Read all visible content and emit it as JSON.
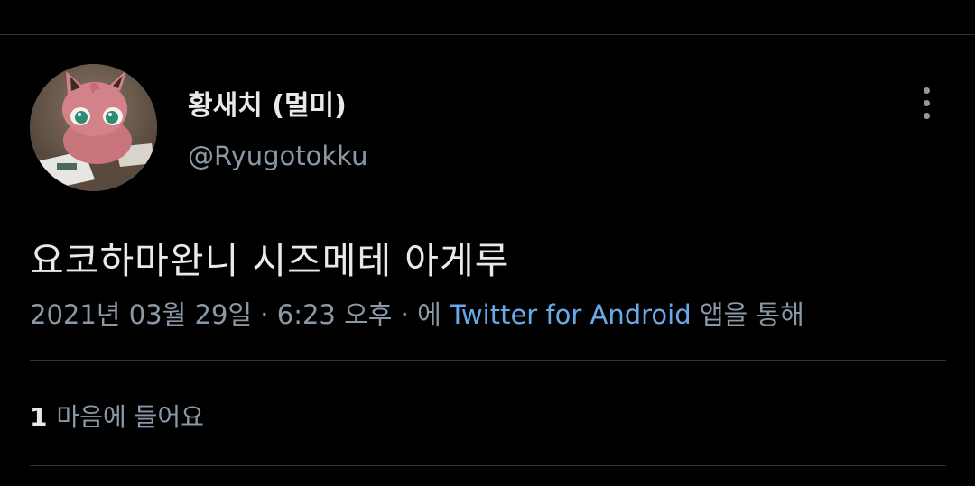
{
  "tweet": {
    "author": {
      "display_name": "황새치 (멀미)",
      "handle": "@Ryugotokku"
    },
    "text": "요코하마완니 시즈메테 아게루",
    "meta": {
      "date": "2021년 03월 29일",
      "separator1": " · ",
      "time": "6:23 오후",
      "separator2": " · ",
      "via_prefix": "에 ",
      "source": "Twitter for Android",
      "via_suffix": " 앱을 통해"
    },
    "stats": {
      "likes_count": "1",
      "likes_label": "마음에 들어요"
    }
  },
  "colors": {
    "background": "#000000",
    "primary_text": "#e7e9ea",
    "secondary_text": "#8b98a5",
    "link": "#6aa9e9",
    "divider": "#2f3336"
  },
  "icons": {
    "more_menu": "more-vertical-icon"
  }
}
